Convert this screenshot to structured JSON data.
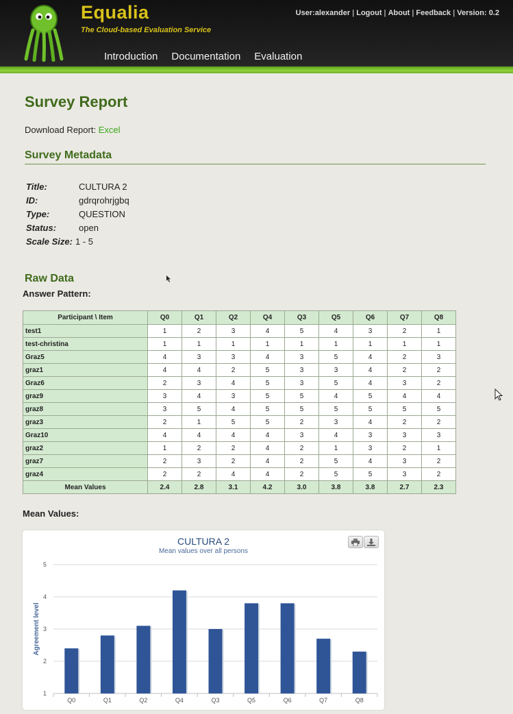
{
  "app": {
    "brand": "Equalia",
    "tagline": "The Cloud-based Evaluation Service",
    "user_links": [
      "User:alexander",
      "Logout",
      "About",
      "Feedback",
      "Version: 0.2"
    ],
    "nav": [
      "Introduction",
      "Documentation",
      "Evaluation"
    ]
  },
  "report": {
    "title": "Survey Report",
    "download_label": "Download Report:",
    "download_link": "Excel",
    "metadata_heading": "Survey Metadata",
    "metadata": [
      {
        "key": "Title:",
        "value": "CULTURA 2"
      },
      {
        "key": "ID:",
        "value": "gdrqrohrjgbq"
      },
      {
        "key": "Type:",
        "value": "QUESTION"
      },
      {
        "key": "Status:",
        "value": "open"
      },
      {
        "key": "Scale Size:",
        "value": "1 - 5"
      }
    ],
    "raw_heading": "Raw Data",
    "answer_pattern_label": "Answer Pattern:",
    "mean_values_label": "Mean Values:"
  },
  "table": {
    "header": [
      "Participant \\ Item",
      "Q0",
      "Q1",
      "Q2",
      "Q4",
      "Q3",
      "Q5",
      "Q6",
      "Q7",
      "Q8"
    ],
    "rows": [
      {
        "name": "test1",
        "values": [
          "1",
          "2",
          "3",
          "4",
          "5",
          "4",
          "3",
          "2",
          "1"
        ]
      },
      {
        "name": "test-christina",
        "values": [
          "1",
          "1",
          "1",
          "1",
          "1",
          "1",
          "1",
          "1",
          "1"
        ]
      },
      {
        "name": "Graz5",
        "values": [
          "4",
          "3",
          "3",
          "4",
          "3",
          "5",
          "4",
          "2",
          "3"
        ]
      },
      {
        "name": "graz1",
        "values": [
          "4",
          "4",
          "2",
          "5",
          "3",
          "3",
          "4",
          "2",
          "2"
        ]
      },
      {
        "name": "Graz6",
        "values": [
          "2",
          "3",
          "4",
          "5",
          "3",
          "5",
          "4",
          "3",
          "2"
        ]
      },
      {
        "name": "graz9",
        "values": [
          "3",
          "4",
          "3",
          "5",
          "5",
          "4",
          "5",
          "4",
          "4"
        ]
      },
      {
        "name": "graz8",
        "values": [
          "3",
          "5",
          "4",
          "5",
          "5",
          "5",
          "5",
          "5",
          "5"
        ]
      },
      {
        "name": "graz3",
        "values": [
          "2",
          "1",
          "5",
          "5",
          "2",
          "3",
          "4",
          "2",
          "2"
        ]
      },
      {
        "name": "Graz10",
        "values": [
          "4",
          "4",
          "4",
          "4",
          "3",
          "4",
          "3",
          "3",
          "3"
        ]
      },
      {
        "name": "graz2",
        "values": [
          "1",
          "2",
          "2",
          "4",
          "2",
          "1",
          "3",
          "2",
          "1"
        ]
      },
      {
        "name": "graz7",
        "values": [
          "2",
          "3",
          "2",
          "4",
          "2",
          "5",
          "4",
          "3",
          "2"
        ]
      },
      {
        "name": "graz4",
        "values": [
          "2",
          "2",
          "4",
          "4",
          "2",
          "5",
          "5",
          "3",
          "2"
        ]
      }
    ],
    "mean": {
      "name": "Mean Values",
      "values": [
        "2.4",
        "2.8",
        "3.1",
        "4.2",
        "3.0",
        "3.8",
        "3.8",
        "2.7",
        "2.3"
      ]
    }
  },
  "chart_data": {
    "type": "bar",
    "title": "CULTURA 2",
    "subtitle": "Mean values over all persons",
    "ylabel": "Agreement level",
    "xlabel": "",
    "categories": [
      "Q0",
      "Q1",
      "Q2",
      "Q4",
      "Q3",
      "Q5",
      "Q6",
      "Q7",
      "Q8"
    ],
    "values": [
      2.4,
      2.8,
      3.1,
      4.2,
      3.0,
      3.8,
      3.8,
      2.7,
      2.3
    ],
    "ylim": [
      1,
      5
    ],
    "yticks": [
      "1",
      "2",
      "3",
      "4",
      "5"
    ],
    "grid": true,
    "legend": "none",
    "bar_color": "#2f5597"
  },
  "colors": {
    "accent_green": "#3f6b1c",
    "link_green": "#3aa51a",
    "brand_yellow": "#d9c21a",
    "table_header": "#d4ead0"
  },
  "icons": [
    "octopus-logo",
    "print-icon",
    "download-icon",
    "mouse-cursor"
  ]
}
